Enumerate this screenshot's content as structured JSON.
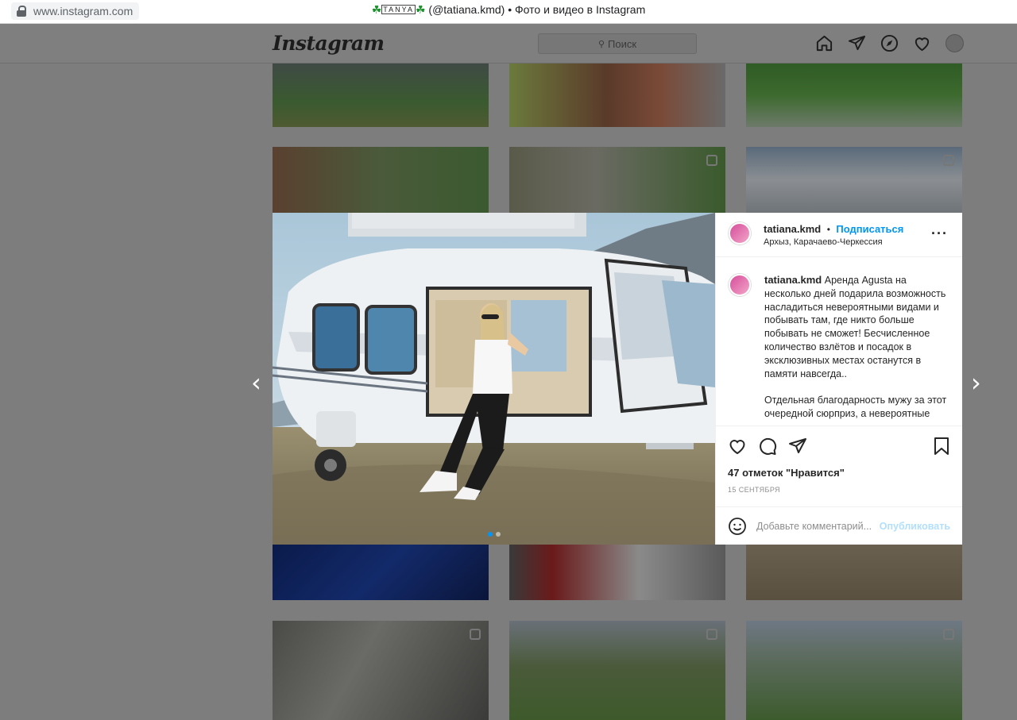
{
  "browser": {
    "url": "www.instagram.com",
    "title_name": "TANYA",
    "title_rest": "(@tatiana.kmd) • Фото и видео в Instagram",
    "clover": "☘"
  },
  "header": {
    "logo": "Instagram",
    "search_placeholder": "Поиск"
  },
  "post": {
    "username": "tatiana.kmd",
    "follow_label": "Подписаться",
    "separator": "•",
    "location": "Архыз, Карачаево-Черкессия",
    "caption_username": "tatiana.kmd",
    "caption_p1": "Аренда Agusta на несколько дней подарила возможность насладиться невероятными видами и побывать там, где никто больше побывать не сможет! Бесчисленное количество взлётов и посадок в эксклюзивных местах останутся в памяти навсегда..",
    "caption_p2": "Отдельная благодарность мужу за этот очередной сюрприз, а невероятные",
    "likes": "47 отметок \"Нравится\"",
    "date": "15 СЕНТЯБРЯ",
    "comment_placeholder": "Добавьте комментарий...",
    "publish_label": "Опубликовать",
    "more_label": "···"
  },
  "colors": {
    "link_blue": "#0095f6",
    "publish_disabled": "#b2dffc"
  }
}
